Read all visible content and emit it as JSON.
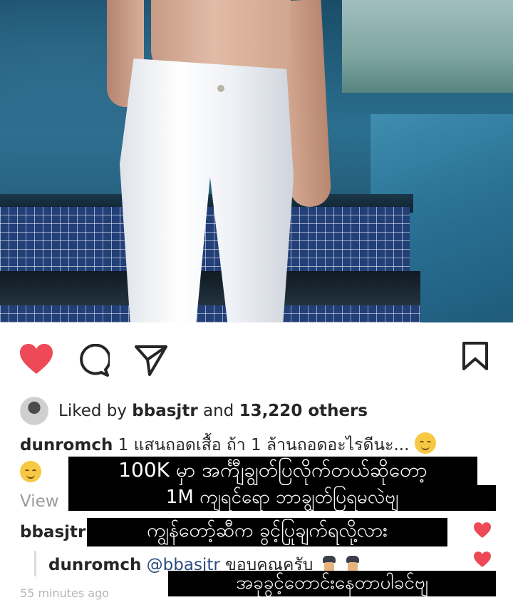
{
  "post": {
    "liked_by_prefix": "Liked by",
    "liked_by_user": "bbasjtr",
    "liked_by_mid": "and",
    "liked_by_count": "13,220 others"
  },
  "icons": {
    "like": "heart-icon-filled",
    "comment": "comment-icon",
    "share": "send-icon",
    "save": "bookmark-icon",
    "emoji": "relieved-face-emoji",
    "guard": "guard-emoji"
  },
  "colors": {
    "heart": "#ed4956",
    "mention": "#2b4c7e",
    "overlay_bg": "#000000",
    "overlay_text": "#ffffff"
  },
  "caption": {
    "user": "dunromch",
    "text": "1 แสนถอดเสื้อ ถ้า 1 ล้านถอดอะไรดีนะ..."
  },
  "view_text": "View",
  "comments": [
    {
      "user": "bbasjtr",
      "text": ""
    },
    {
      "user": "dunromch",
      "mention": "@bbasjtr",
      "text": "ขอบคุณครับ"
    }
  ],
  "overlays": {
    "line1": "100K မှာ အင်္ကျီချွတ်ပြလိုက်တယ်ဆိုတော့",
    "line2": "1M ကျရင်ရော ဘာချွတ်ပြရမလဲဗျ",
    "line3": "ကျွန်တော့်ဆီက ခွင့်ပြုချက်ရလို့လား",
    "line4": "အခုခွင့်တောင်းနေတာပါခင်ဗျ"
  },
  "bottom_peek": "55 minutes ago"
}
